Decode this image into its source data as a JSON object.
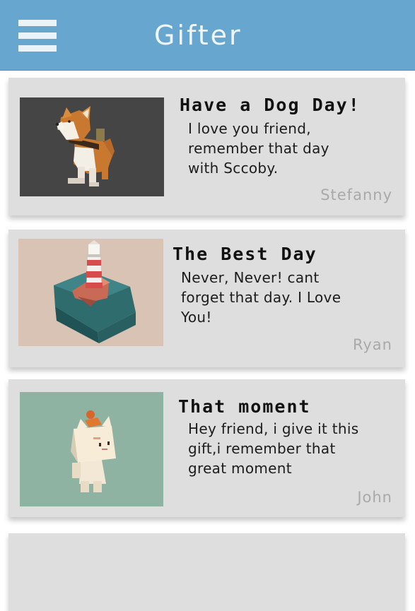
{
  "header": {
    "title": "Gifter",
    "menu_icon": "hamburger-menu-icon",
    "background_color": "#67a6cf"
  },
  "cards": [
    {
      "title": "Have a Dog Day!",
      "message": "I love you friend, remember that day with Sccoby.",
      "author": "Stefanny",
      "image": "corgi-dog-image"
    },
    {
      "title": "The Best Day",
      "message": "Never, Never! cant forget that day. I Love You!",
      "author": "Ryan",
      "image": "lighthouse-image"
    },
    {
      "title": "That moment",
      "message": "Hey friend, i give it this gift,i remember that great moment",
      "author": "John",
      "image": "cat-character-image"
    }
  ]
}
